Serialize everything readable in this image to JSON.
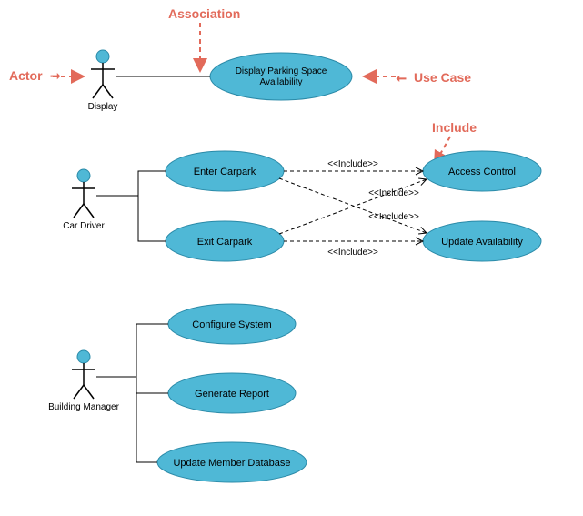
{
  "chart_data": {
    "type": "uml_use_case",
    "actors": [
      {
        "id": "display",
        "name": "Display"
      },
      {
        "id": "car_driver",
        "name": "Car Driver"
      },
      {
        "id": "building_manager",
        "name": "Building Manager"
      }
    ],
    "use_cases": [
      {
        "id": "display_availability",
        "name": "Display Parking Space Availability"
      },
      {
        "id": "enter_carpark",
        "name": "Enter Carpark"
      },
      {
        "id": "exit_carpark",
        "name": "Exit Carpark"
      },
      {
        "id": "access_control",
        "name": "Access Control"
      },
      {
        "id": "update_availability",
        "name": "Update Availability"
      },
      {
        "id": "configure_system",
        "name": "Configure System"
      },
      {
        "id": "generate_report",
        "name": "Generate Report"
      },
      {
        "id": "update_member_db",
        "name": "Update Member Database"
      }
    ],
    "associations": [
      {
        "actor": "display",
        "use_case": "display_availability"
      },
      {
        "actor": "car_driver",
        "use_case": "enter_carpark"
      },
      {
        "actor": "car_driver",
        "use_case": "exit_carpark"
      },
      {
        "actor": "building_manager",
        "use_case": "configure_system"
      },
      {
        "actor": "building_manager",
        "use_case": "generate_report"
      },
      {
        "actor": "building_manager",
        "use_case": "update_member_db"
      }
    ],
    "includes": [
      {
        "from": "enter_carpark",
        "to": "access_control",
        "label": "<<Include>>"
      },
      {
        "from": "enter_carpark",
        "to": "update_availability",
        "label": "<<Include>>"
      },
      {
        "from": "exit_carpark",
        "to": "access_control",
        "label": "<<Include>>"
      },
      {
        "from": "exit_carpark",
        "to": "update_availability",
        "label": "<<Include>>"
      }
    ],
    "annotations": [
      {
        "text": "Association",
        "points_to": "association"
      },
      {
        "text": "Actor",
        "points_to": "actor"
      },
      {
        "text": "Use Case",
        "points_to": "use_case"
      },
      {
        "text": "Include",
        "points_to": "include"
      }
    ]
  },
  "labels": {
    "actor_display": "Display",
    "actor_driver": "Car Driver",
    "actor_manager": "Building Manager",
    "uc_display_line1": "Display Parking Space",
    "uc_display_line2": "Availability",
    "uc_enter": "Enter Carpark",
    "uc_exit": "Exit Carpark",
    "uc_access": "Access Control",
    "uc_update_avail": "Update Availability",
    "uc_configure": "Configure System",
    "uc_report": "Generate Report",
    "uc_member_db": "Update Member Database",
    "include": "<<Include>>",
    "annot_actor": "Actor",
    "annot_assoc": "Association",
    "annot_usecase": "Use Case",
    "annot_include": "Include",
    "annot_arrow": "➞"
  }
}
